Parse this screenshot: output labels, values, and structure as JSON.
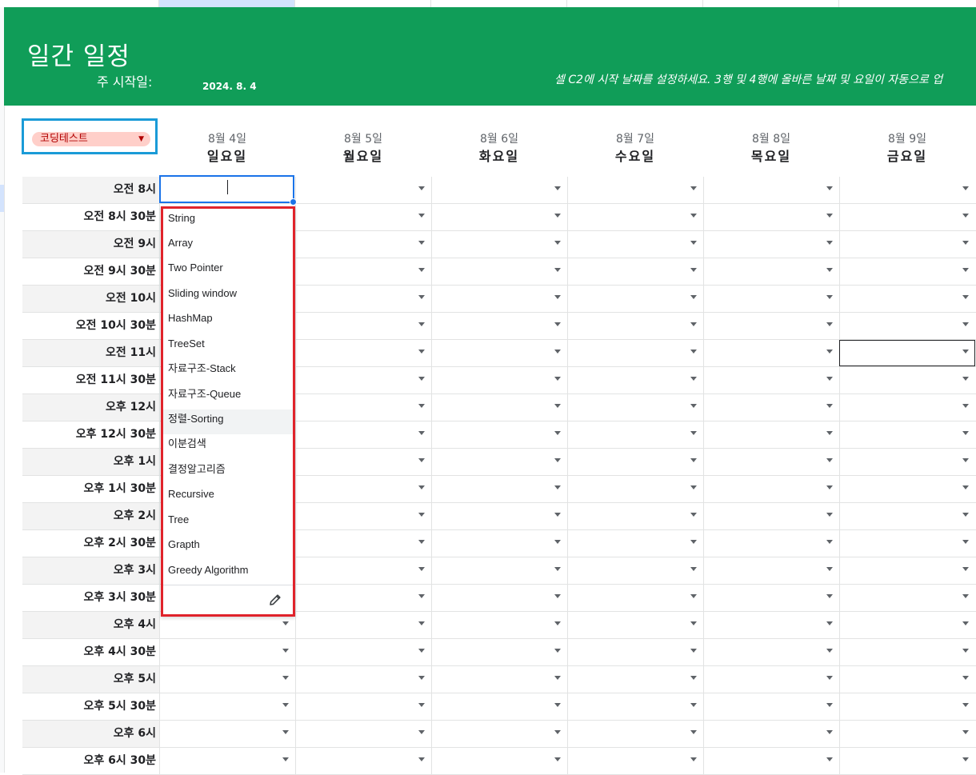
{
  "header": {
    "title": "일간 일정",
    "start_label": "주 시작일:",
    "start_date": "2024. 8. 4",
    "hint": "셀 C2에 시작 날짜를 설정하세요. 3행 및 4행에 올바른 날짜 및 요일이 자동으로 업"
  },
  "category": {
    "label": "코딩테스트"
  },
  "days": [
    {
      "date": "8월 4일",
      "dow": "일요일"
    },
    {
      "date": "8월 5일",
      "dow": "월요일"
    },
    {
      "date": "8월 6일",
      "dow": "화요일"
    },
    {
      "date": "8월 7일",
      "dow": "수요일"
    },
    {
      "date": "8월 8일",
      "dow": "목요일"
    },
    {
      "date": "8월 9일",
      "dow": "금요일"
    }
  ],
  "times": [
    "오전 8시",
    "오전 8시 30분",
    "오전 9시",
    "오전 9시 30분",
    "오전 10시",
    "오전 10시 30분",
    "오전 11시",
    "오전 11시 30분",
    "오후 12시",
    "오후 12시 30분",
    "오후 1시",
    "오후 1시 30분",
    "오후 2시",
    "오후 2시 30분",
    "오후 3시",
    "오후 3시 30분",
    "오후 4시",
    "오후 4시 30분",
    "오후 5시",
    "오후 5시 30분",
    "오후 6시",
    "오후 6시 30분"
  ],
  "dropdown": {
    "options": [
      "String",
      "Array",
      "Two Pointer",
      "Sliding window",
      "HashMap",
      "TreeSet",
      "자료구조-Stack",
      "자료구조-Queue",
      "정렬-Sorting",
      "이분검색",
      "결정알고리즘",
      "Recursive",
      "Tree",
      "Grapth",
      "Greedy Algorithm"
    ],
    "hovered_option": "정렬-Sorting",
    "edit_icon": "pencil-icon"
  },
  "colors": {
    "banner": "#109d58",
    "chip_bg": "#ffcfc9",
    "chip_text": "#b10202",
    "active_border": "#1a73e8",
    "dropdown_highlight": "#e0232b",
    "chip_highlight": "#1a9bd7"
  }
}
